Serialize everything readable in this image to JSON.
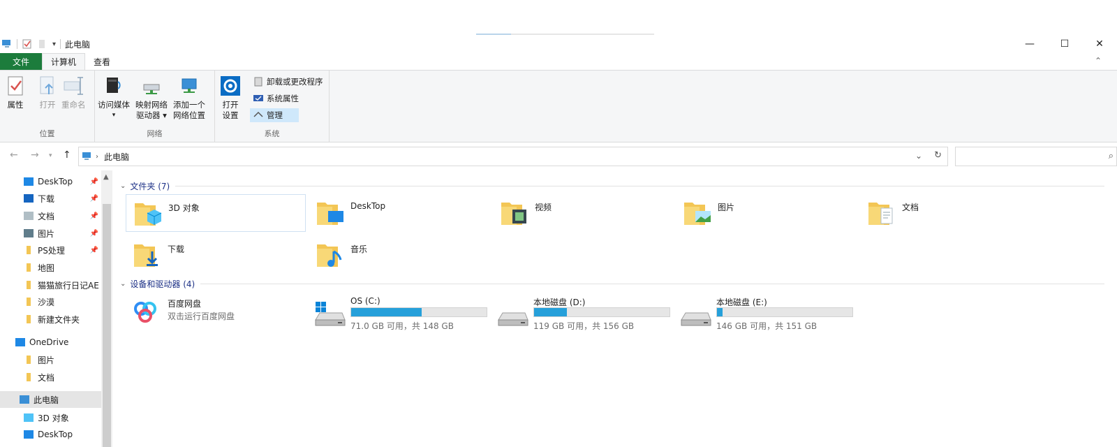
{
  "window": {
    "title": "此电脑",
    "minimize": "—",
    "maximize": "☐",
    "close": "✕"
  },
  "tabs": [
    {
      "label": "文件"
    },
    {
      "label": "计算机"
    },
    {
      "label": "查看"
    }
  ],
  "ribbon": {
    "location_group": {
      "label": "位置",
      "properties": "属性",
      "open": "打开",
      "rename": "重命名"
    },
    "network_group": {
      "label": "网络",
      "access_media": "访问媒体",
      "map_drive_1": "映射网络",
      "map_drive_2": "驱动器 ▾",
      "add_location_1": "添加一个",
      "add_location_2": "网络位置"
    },
    "system_group": {
      "label": "系统",
      "open_settings_1": "打开",
      "open_settings_2": "设置",
      "uninstall": "卸载或更改程序",
      "system_properties": "系统属性",
      "manage": "管理"
    }
  },
  "address": {
    "crumb": "此电脑",
    "back": "←",
    "forward": "→",
    "up": "↑",
    "dropdown": "⌄",
    "refresh": "↻",
    "search_icon": "⌕"
  },
  "nav": {
    "items": [
      {
        "label": "DeskTop",
        "pinned": true
      },
      {
        "label": "下载",
        "pinned": true
      },
      {
        "label": "文档",
        "pinned": true
      },
      {
        "label": "图片",
        "pinned": true
      },
      {
        "label": "PS处理",
        "pinned": true
      },
      {
        "label": "地图",
        "pinned": false
      },
      {
        "label": "猫猫旅行日记AE",
        "pinned": false
      },
      {
        "label": "沙漠",
        "pinned": false
      },
      {
        "label": "新建文件夹",
        "pinned": false
      },
      {
        "label": "OneDrive",
        "pinned": false
      },
      {
        "label": "图片",
        "pinned": false
      },
      {
        "label": "文档",
        "pinned": false
      },
      {
        "label": "此电脑",
        "pinned": false
      },
      {
        "label": "3D 对象",
        "pinned": false
      },
      {
        "label": "DeskTop",
        "pinned": false
      }
    ],
    "pin_glyph": "📌",
    "scroll_up": "▲"
  },
  "sections": {
    "folders_header": "文件夹 (7)",
    "devices_header": "设备和驱动器 (4)",
    "chevron": "⌄"
  },
  "folders": [
    {
      "name": "3D 对象"
    },
    {
      "name": "DeskTop"
    },
    {
      "name": "视频"
    },
    {
      "name": "图片"
    },
    {
      "name": "文档"
    },
    {
      "name": "下载"
    },
    {
      "name": "音乐"
    }
  ],
  "app": {
    "name": "百度网盘",
    "desc": "双击运行百度网盘"
  },
  "drives": [
    {
      "name": "OS (C:)",
      "size": "71.0 GB 可用，共 148 GB",
      "used": 0.52
    },
    {
      "name": "本地磁盘 (D:)",
      "size": "119 GB 可用，共 156 GB",
      "used": 0.24
    },
    {
      "name": "本地磁盘 (E:)",
      "size": "146 GB 可用，共 151 GB",
      "used": 0.04
    }
  ],
  "colors": {
    "file_tab": "#1c7c3c",
    "drive_bar": "#26a0da",
    "selection": "#cfe8fb",
    "folder": "#f3c655"
  }
}
